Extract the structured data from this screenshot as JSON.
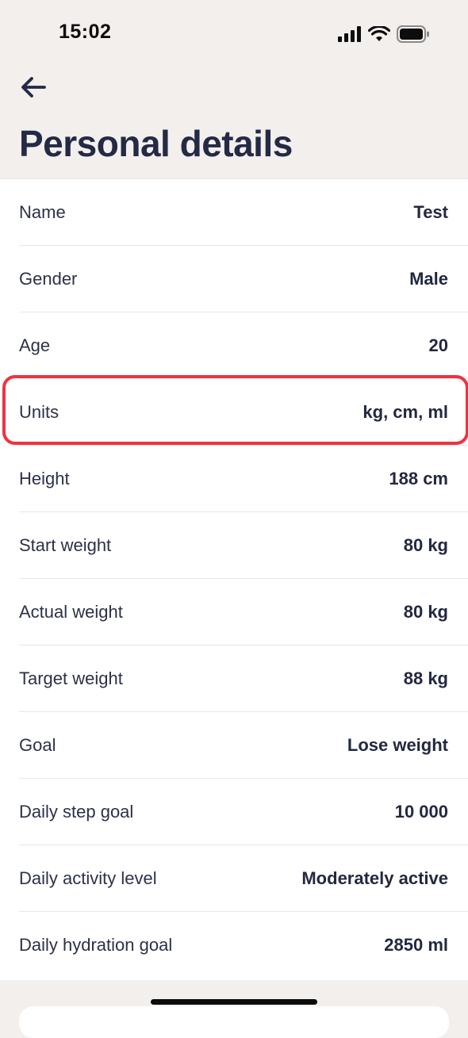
{
  "status_bar": {
    "time": "15:02",
    "icons": [
      "cellular-signal-icon",
      "wifi-icon",
      "battery-icon"
    ]
  },
  "header": {
    "back_icon": "arrow-left-icon",
    "title": "Personal details"
  },
  "details": [
    {
      "label": "Name",
      "value": "Test"
    },
    {
      "label": "Gender",
      "value": "Male"
    },
    {
      "label": "Age",
      "value": "20"
    },
    {
      "label": "Units",
      "value": "kg, cm, ml"
    },
    {
      "label": "Height",
      "value": "188 cm"
    },
    {
      "label": "Start weight",
      "value": "80 kg"
    },
    {
      "label": "Actual weight",
      "value": "80 kg"
    },
    {
      "label": "Target weight",
      "value": "88 kg"
    },
    {
      "label": "Goal",
      "value": "Lose weight"
    },
    {
      "label": "Daily step goal",
      "value": "10 000"
    },
    {
      "label": "Daily activity level",
      "value": "Moderately active"
    },
    {
      "label": "Daily hydration goal",
      "value": "2850 ml"
    }
  ],
  "colors": {
    "background": "#f2efed",
    "title": "#242a45",
    "highlight": "#ee3340"
  }
}
